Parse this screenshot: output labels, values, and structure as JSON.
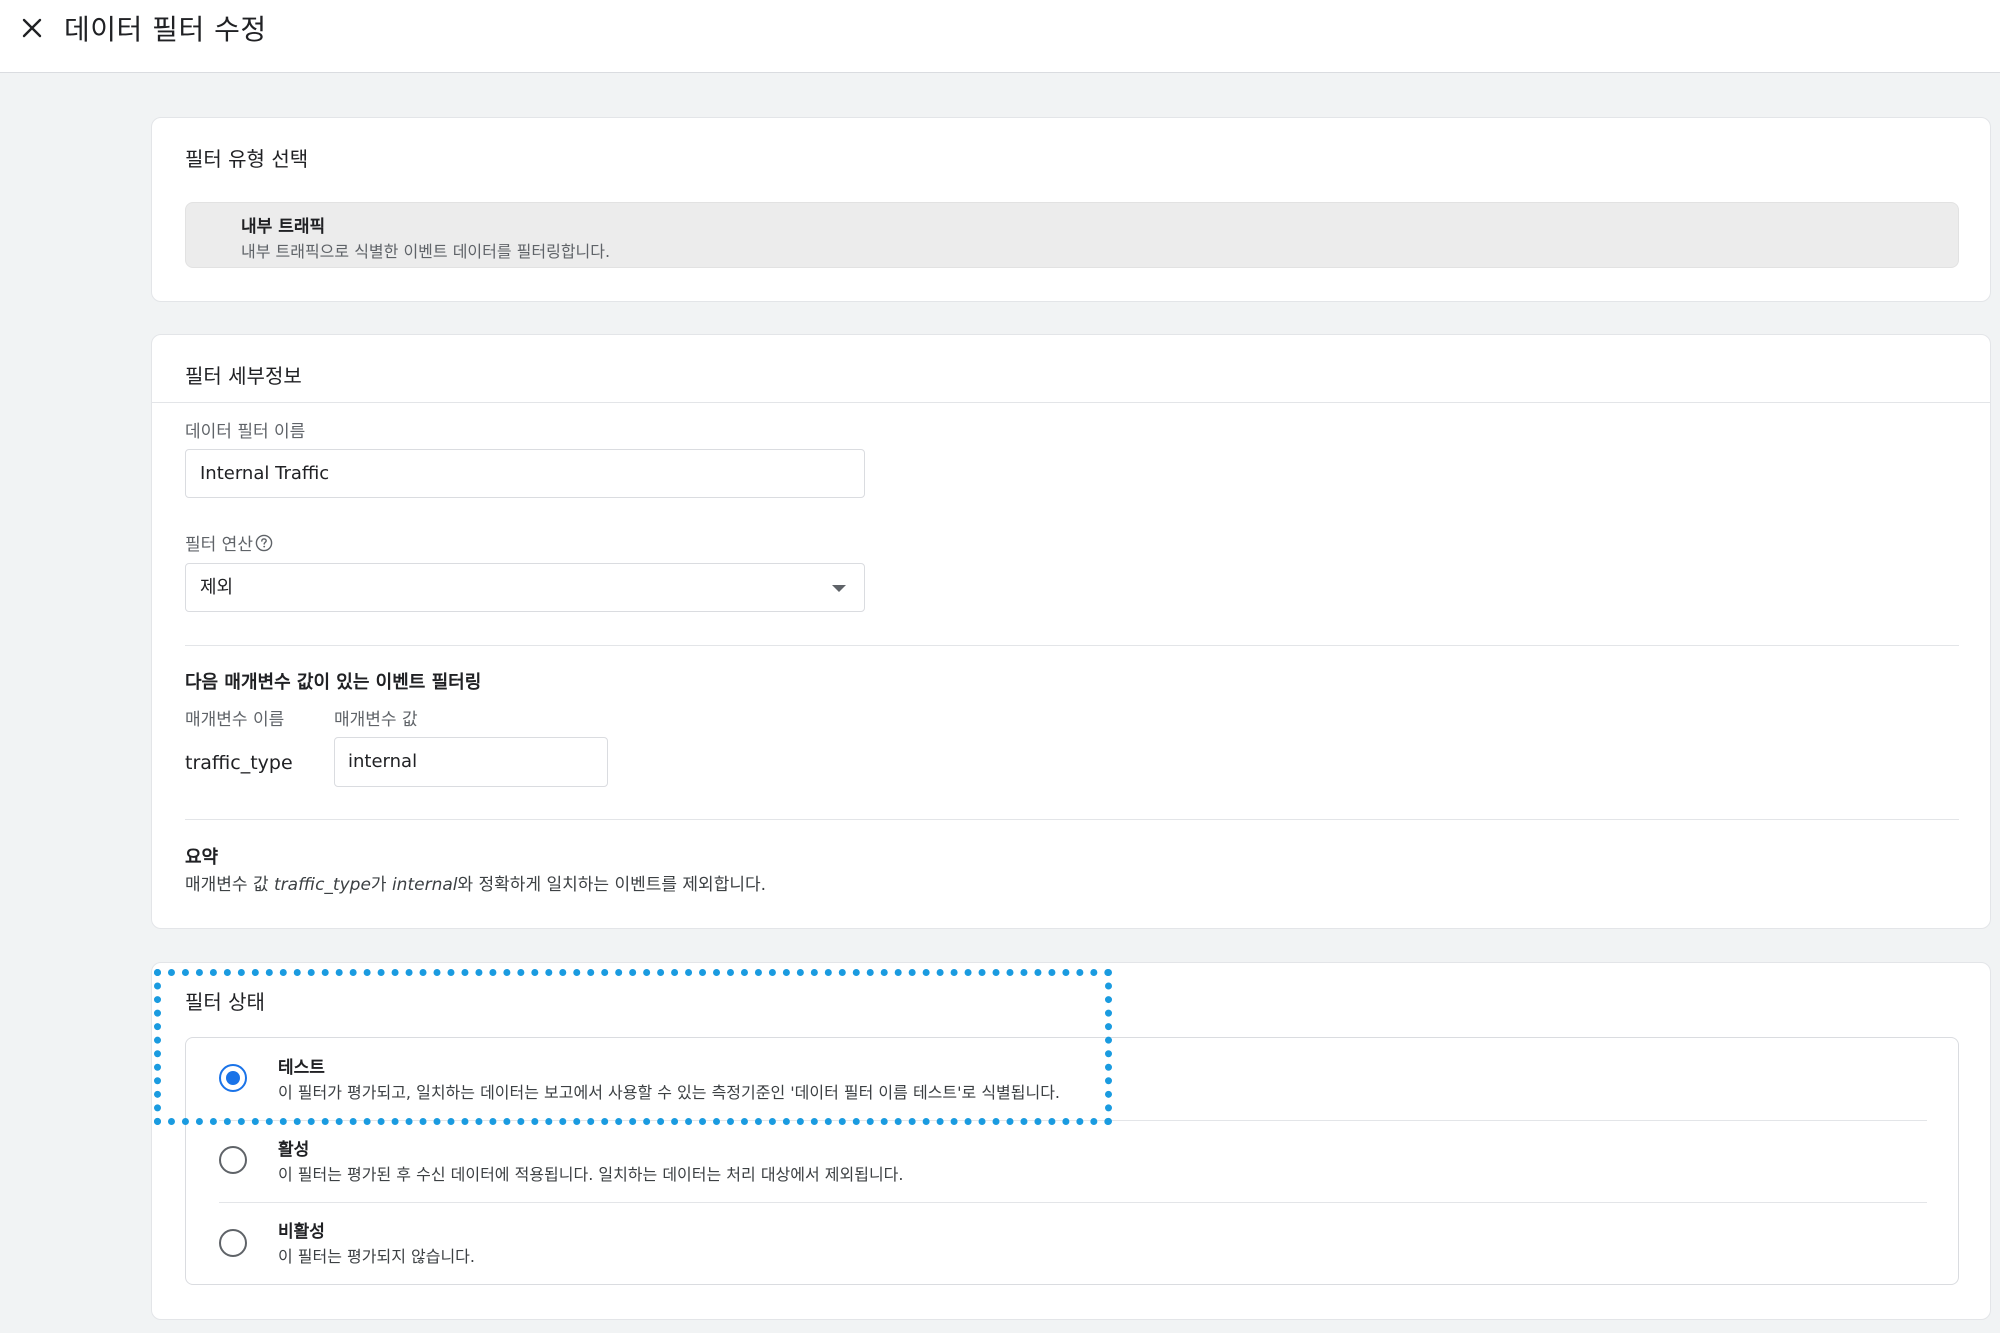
{
  "header": {
    "title": "데이터 필터 수정",
    "close_icon": "close-icon"
  },
  "filter_type": {
    "section_title": "필터 유형 선택",
    "option_title": "내부 트래픽",
    "option_desc": "내부 트래픽으로 식별한 이벤트 데이터를 필터링합니다."
  },
  "filter_details": {
    "section_title": "필터 세부정보",
    "name_label": "데이터 필터 이름",
    "name_value": "Internal Traffic",
    "operation_label": "필터 연산",
    "operation_help_icon": "help-circle-icon",
    "operation_value": "제외",
    "param_section_title": "다음 매개변수 값이 있는 이벤트 필터링",
    "param_name_label": "매개변수 이름",
    "param_value_label": "매개변수 값",
    "param_name": "traffic_type",
    "param_value": "internal",
    "summary_title": "요약",
    "summary_prefix": "매개변수 값 ",
    "summary_param": "traffic_type",
    "summary_mid": "가 ",
    "summary_value": "internal",
    "summary_suffix": "와 정확하게 일치하는 이벤트를 제외합니다."
  },
  "filter_status": {
    "section_title": "필터 상태",
    "selected": "test",
    "options": [
      {
        "id": "test",
        "title": "테스트",
        "desc": "이 필터가 평가되고, 일치하는 데이터는 보고에서 사용할 수 있는 측정기준인 '데이터 필터 이름 테스트'로 식별됩니다."
      },
      {
        "id": "active",
        "title": "활성",
        "desc": "이 필터는 평가된 후 수신 데이터에 적용됩니다. 일치하는 데이터는 처리 대상에서 제외됩니다."
      },
      {
        "id": "inactive",
        "title": "비활성",
        "desc": "이 필터는 평가되지 않습니다."
      }
    ]
  },
  "colors": {
    "accent": "#1a73e8",
    "highlight_border": "#1a9be0"
  }
}
